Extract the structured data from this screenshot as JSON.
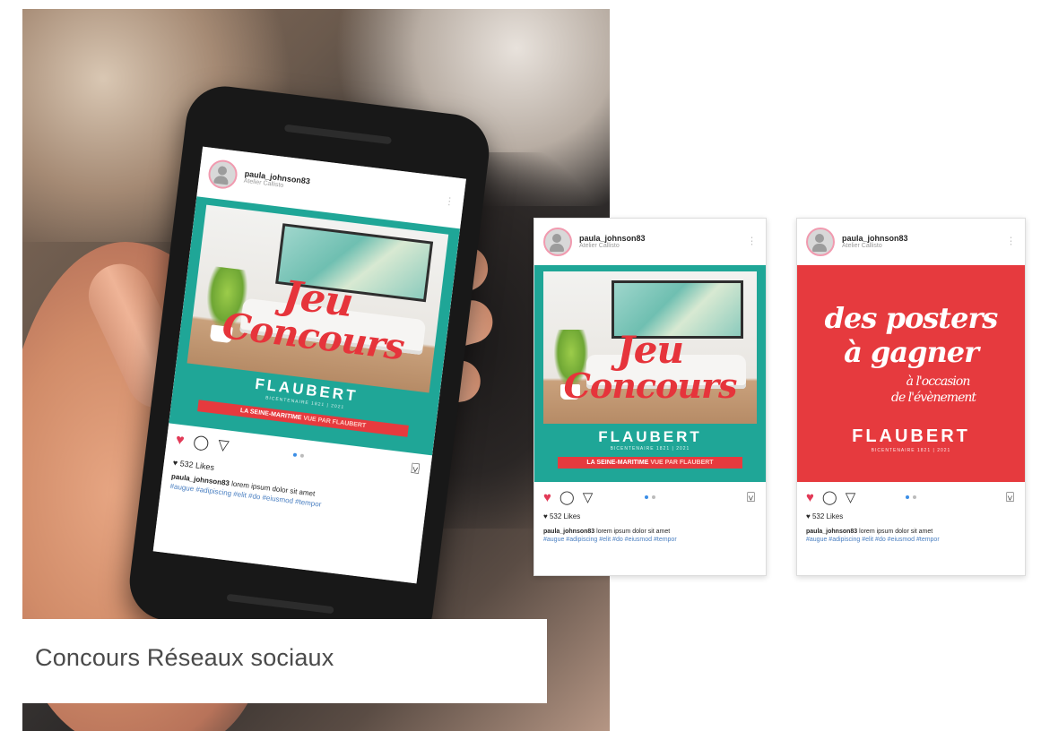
{
  "caption": "Concours Réseaux sociaux",
  "colors": {
    "teal": "#1fa697",
    "red": "#e63a3e",
    "heart": "#e23a57",
    "hashtag": "#4a7fc1"
  },
  "icons": [
    "heart-icon",
    "comment-icon",
    "send-icon",
    "bookmark-icon",
    "more-icon",
    "avatar-icon"
  ],
  "posts": [
    {
      "username": "paula_johnson83",
      "location": "Atelier Callisto",
      "script_line1": "Jeu",
      "script_line2": "Concours",
      "brand": "FLAUBERT",
      "brand_sub": "BICENTENAIRE 1821 | 2021",
      "banner_main": "LA SEINE-MARITIME",
      "banner_highlight": "VUE PAR FLAUBERT",
      "likes": "♥ 532 Likes",
      "caption_user": "paula_johnson83",
      "caption_text": "lorem ipsum dolor sit amet",
      "hashtags": "#augue #adipiscing #elit #do #eiusmod #tempor"
    },
    {
      "username": "paula_johnson83",
      "location": "Atelier Callisto",
      "headline_line1": "des posters",
      "headline_line2": "à gagner",
      "subline1": "à l'occasion",
      "subline2": "de l'évènement",
      "brand": "FLAUBERT",
      "brand_sub": "BICENTENAIRE 1821 | 2021",
      "likes": "♥ 532 Likes",
      "caption_user": "paula_johnson83",
      "caption_text": "lorem ipsum dolor sit amet",
      "hashtags": "#augue #adipiscing #elit #do #eiusmod #tempor"
    }
  ]
}
